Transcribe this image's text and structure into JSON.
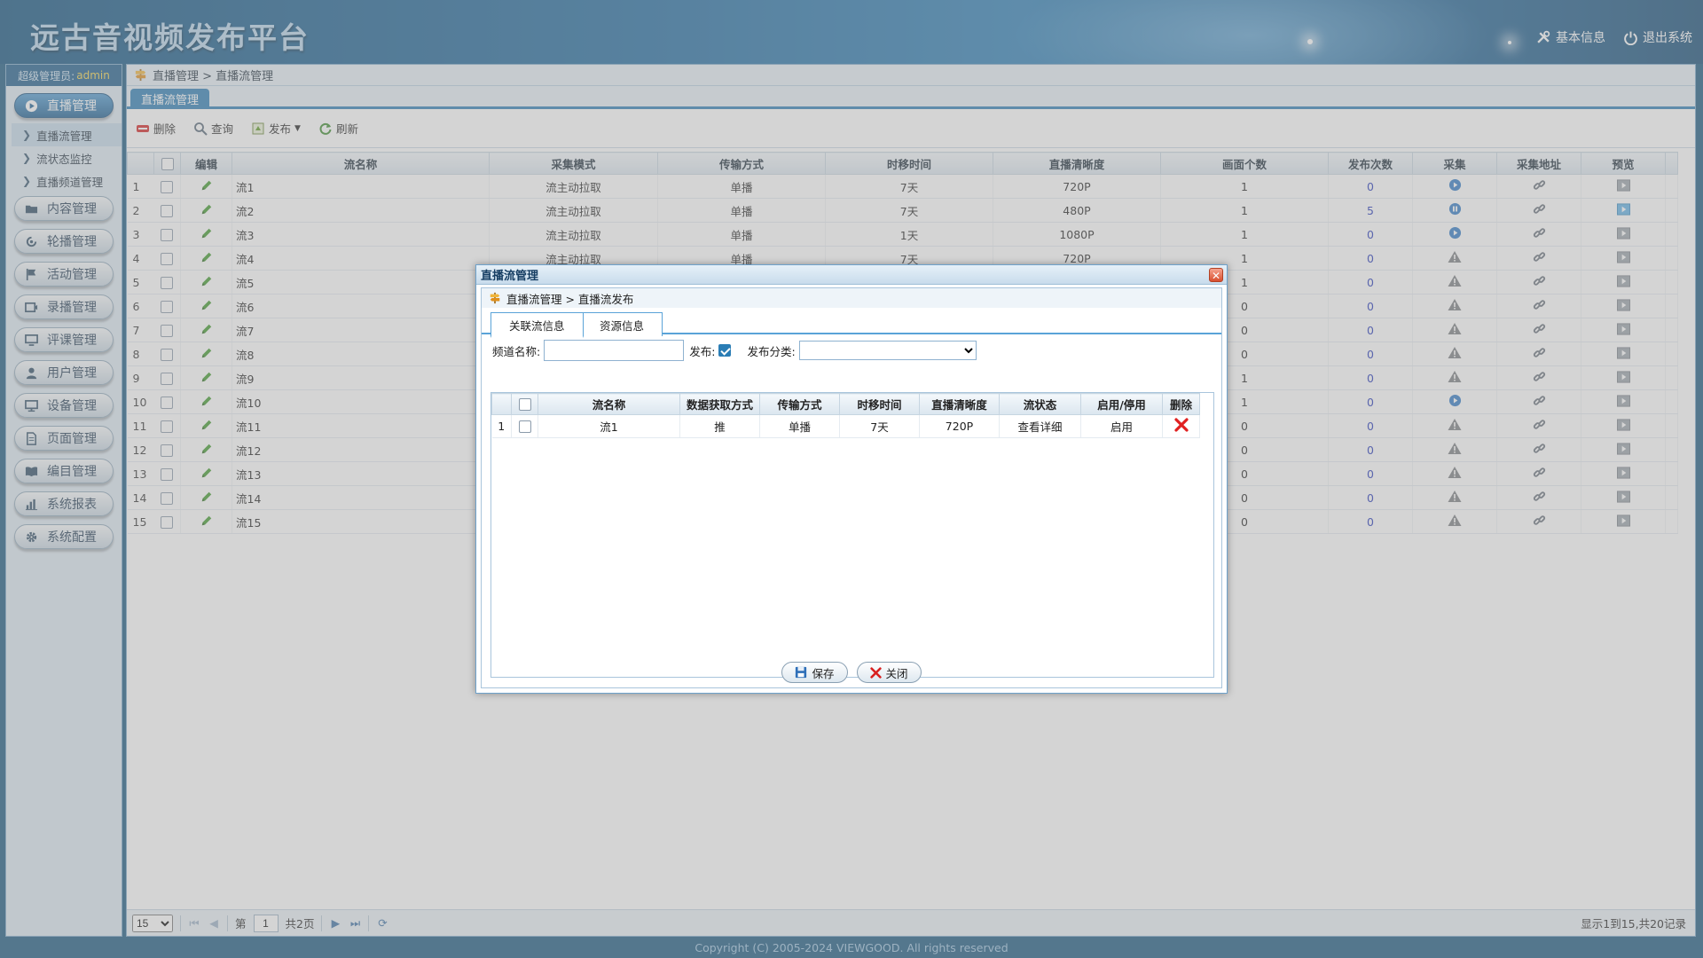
{
  "header": {
    "app_title": "远古音视频发布平台",
    "links": [
      {
        "label": "基本信息",
        "icon": "tools-icon"
      },
      {
        "label": "退出系统",
        "icon": "power-icon"
      }
    ]
  },
  "sidebar": {
    "admin_prefix": "超级管理员:",
    "admin_name": "admin",
    "menus": [
      {
        "label": "直播管理",
        "icon": "play-circle-icon",
        "active": true
      },
      {
        "label": "内容管理",
        "icon": "folder-icon"
      },
      {
        "label": "轮播管理",
        "icon": "carousel-icon"
      },
      {
        "label": "活动管理",
        "icon": "flag-icon"
      },
      {
        "label": "录播管理",
        "icon": "record-icon"
      },
      {
        "label": "评课管理",
        "icon": "monitor-icon"
      },
      {
        "label": "用户管理",
        "icon": "user-icon"
      },
      {
        "label": "设备管理",
        "icon": "screen-icon"
      },
      {
        "label": "页面管理",
        "icon": "page-icon"
      },
      {
        "label": "编目管理",
        "icon": "book-icon"
      },
      {
        "label": "系统报表",
        "icon": "chart-icon"
      },
      {
        "label": "系统配置",
        "icon": "gear-icon"
      }
    ],
    "submenu": [
      "直播流管理",
      "流状态监控",
      "直播频道管理"
    ]
  },
  "main": {
    "breadcrumb": "直播管理 > 直播流管理",
    "tab": "直播流管理",
    "toolbar": {
      "delete": "删除",
      "query": "查询",
      "publish": "发布",
      "refresh": "刷新"
    },
    "columns": [
      "编辑",
      "流名称",
      "采集模式",
      "传输方式",
      "时移时间",
      "直播清晰度",
      "画面个数",
      "发布次数",
      "采集",
      "采集地址",
      "预览"
    ],
    "rows": [
      {
        "n": "1",
        "name": "流1",
        "mode": "流主动拉取",
        "trans": "单播",
        "shift": "7天",
        "res": "720P",
        "screens": "1",
        "pubs": "0",
        "cap": "play"
      },
      {
        "n": "2",
        "name": "流2",
        "mode": "流主动拉取",
        "trans": "单播",
        "shift": "7天",
        "res": "480P",
        "screens": "1",
        "pubs": "5",
        "cap": "pause",
        "preview_active": true
      },
      {
        "n": "3",
        "name": "流3",
        "mode": "流主动拉取",
        "trans": "单播",
        "shift": "1天",
        "res": "1080P",
        "screens": "1",
        "pubs": "0",
        "cap": "play"
      },
      {
        "n": "4",
        "name": "流4",
        "mode": "流主动拉取",
        "trans": "单播",
        "shift": "7天",
        "res": "720P",
        "screens": "1",
        "pubs": "0",
        "cap": "warn"
      },
      {
        "n": "5",
        "name": "流5",
        "screens": "1",
        "pubs": "0",
        "cap": "warn"
      },
      {
        "n": "6",
        "name": "流6",
        "screens": "0",
        "pubs": "0",
        "cap": "warn"
      },
      {
        "n": "7",
        "name": "流7",
        "screens": "0",
        "pubs": "0",
        "cap": "warn"
      },
      {
        "n": "8",
        "name": "流8",
        "screens": "0",
        "pubs": "0",
        "cap": "warn"
      },
      {
        "n": "9",
        "name": "流9",
        "screens": "1",
        "pubs": "0",
        "cap": "warn"
      },
      {
        "n": "10",
        "name": "流10",
        "screens": "1",
        "pubs": "0",
        "cap": "play"
      },
      {
        "n": "11",
        "name": "流11",
        "screens": "0",
        "pubs": "0",
        "cap": "warn"
      },
      {
        "n": "12",
        "name": "流12",
        "screens": "0",
        "pubs": "0",
        "cap": "warn"
      },
      {
        "n": "13",
        "name": "流13",
        "screens": "0",
        "pubs": "0",
        "cap": "warn"
      },
      {
        "n": "14",
        "name": "流14",
        "screens": "0",
        "pubs": "0",
        "cap": "warn"
      },
      {
        "n": "15",
        "name": "流15",
        "screens": "0",
        "pubs": "0",
        "cap": "warn"
      }
    ],
    "pager": {
      "page_size": "15",
      "page_prefix": "第",
      "page_value": "1",
      "page_total": "共2页",
      "info": "显示1到15,共20记录"
    }
  },
  "dialog": {
    "title": "直播流管理",
    "breadcrumb": "直播流管理 > 直播流发布",
    "tabs": [
      "关联流信息",
      "资源信息"
    ],
    "form": {
      "channel_label": "频道名称:",
      "channel_value": "",
      "publish_label": "发布:",
      "category_label": "发布分类:",
      "category_value": ""
    },
    "columns": [
      "流名称",
      "数据获取方式",
      "传输方式",
      "时移时间",
      "直播清晰度",
      "流状态",
      "启用/停用",
      "删除"
    ],
    "rows": [
      {
        "n": "1",
        "name": "流1",
        "method": "推",
        "trans": "单播",
        "shift": "7天",
        "res": "720P",
        "status": "查看详细",
        "enable": "启用"
      }
    ],
    "save_label": "保存",
    "close_label": "关闭"
  },
  "footer": {
    "copyright": "Copyright (C) 2005-2024 VIEWGOOD. All rights reserved"
  }
}
